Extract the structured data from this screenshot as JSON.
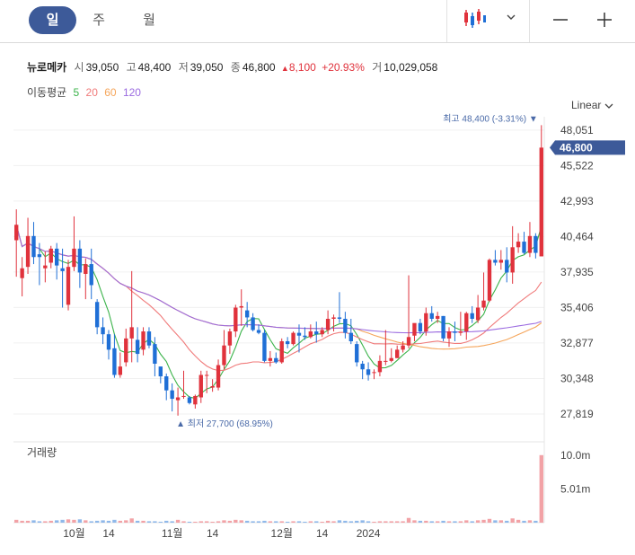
{
  "toolbar": {
    "tabs": [
      {
        "label": "일",
        "active": true
      },
      {
        "label": "주",
        "active": false
      },
      {
        "label": "월",
        "active": false
      }
    ],
    "chart_type_icon": "candlestick-icon",
    "dropdown_icon": "chevron-down-icon",
    "minimize_icon": "minus-icon",
    "add_icon": "plus-icon"
  },
  "quote": {
    "name": "뉴로메카",
    "open_label": "시",
    "open": "39,050",
    "high_label": "고",
    "high": "48,400",
    "low_label": "저",
    "low": "39,050",
    "close_label": "종",
    "close": "46,800",
    "change_icon": "up-triangle-icon",
    "change": "8,100",
    "change_pct": "+20.93%",
    "volume_label": "거",
    "volume": "10,029,058"
  },
  "moving_average": {
    "label": "이동평균",
    "periods": [
      {
        "period": "5",
        "color": "#3bb34a"
      },
      {
        "period": "20",
        "color": "#f07a7a"
      },
      {
        "period": "60",
        "color": "#f5a55a"
      },
      {
        "period": "120",
        "color": "#9b6be0"
      }
    ]
  },
  "scale_mode": "Linear",
  "volume_panel_label": "거래량",
  "colors": {
    "up": "#e0323c",
    "down": "#1f6fd6",
    "accent": "#3d5a99",
    "marker": "#4a6aa8"
  },
  "chart_data": {
    "type": "candlestick",
    "price_axis": {
      "min": 26600,
      "max": 49000,
      "ticks": [
        48051,
        45522,
        42993,
        40464,
        37935,
        35406,
        32877,
        30348,
        27819
      ],
      "tick_labels": [
        "48,051",
        "45,522",
        "42,993",
        "40,464",
        "37,935",
        "35,406",
        "32,877",
        "30,348",
        "27,819"
      ]
    },
    "current_price": {
      "value": 46800,
      "label": "46,800"
    },
    "high_marker": {
      "label": "최고",
      "value": 48400,
      "text": "48,400 (-3.31%)"
    },
    "low_marker": {
      "label": "최저",
      "value": 27700,
      "text": "27,700 (68.95%)"
    },
    "x_labels": [
      {
        "index": 10,
        "label": "10월"
      },
      {
        "index": 16,
        "label": "14"
      },
      {
        "index": 27,
        "label": "11월"
      },
      {
        "index": 34,
        "label": "14"
      },
      {
        "index": 46,
        "label": "12월"
      },
      {
        "index": 53,
        "label": "14"
      },
      {
        "index": 61,
        "label": "2024"
      }
    ],
    "volume_axis": {
      "max": 12000000,
      "ticks": [
        10000000,
        5010000
      ],
      "tick_labels": [
        "10.0m",
        "5.01m"
      ]
    },
    "candles": [
      [
        40200,
        42400,
        41300,
        37600,
        0.6
      ],
      [
        37500,
        39000,
        38200,
        36200,
        0.4
      ],
      [
        38300,
        41800,
        40500,
        37800,
        0.4
      ],
      [
        40500,
        41500,
        39000,
        38500,
        0.5
      ],
      [
        39200,
        40000,
        39000,
        37000,
        0.3
      ],
      [
        38200,
        39400,
        38400,
        37200,
        0.3
      ],
      [
        38600,
        39800,
        39600,
        38200,
        0.4
      ],
      [
        39600,
        40000,
        38400,
        37400,
        0.5
      ],
      [
        38200,
        39600,
        38000,
        35400,
        0.6
      ],
      [
        35600,
        38800,
        38300,
        35200,
        0.7
      ],
      [
        38300,
        41900,
        39600,
        38000,
        0.6
      ],
      [
        39600,
        40200,
        37900,
        36800,
        0.7
      ],
      [
        37800,
        38900,
        38500,
        36000,
        0.5
      ],
      [
        38500,
        39600,
        37000,
        36000,
        0.3
      ],
      [
        35800,
        36000,
        34000,
        33500,
        0.4
      ],
      [
        34000,
        34700,
        33500,
        32800,
        0.5
      ],
      [
        33500,
        33800,
        32400,
        31700,
        0.4
      ],
      [
        32500,
        33500,
        30600,
        30400,
        0.6
      ],
      [
        30600,
        32200,
        31200,
        30400,
        0.4
      ],
      [
        31500,
        33900,
        33200,
        31200,
        0.5
      ],
      [
        33200,
        38000,
        34000,
        31500,
        0.9
      ],
      [
        33100,
        34000,
        32100,
        31500,
        0.4
      ],
      [
        32400,
        34000,
        33700,
        32000,
        0.4
      ],
      [
        33700,
        34000,
        32700,
        32500,
        0.3
      ],
      [
        32800,
        33300,
        31400,
        30500,
        0.3
      ],
      [
        31200,
        31200,
        30500,
        30000,
        0.2
      ],
      [
        30500,
        30700,
        29500,
        28800,
        0.4
      ],
      [
        29500,
        30000,
        28900,
        28000,
        0.3
      ],
      [
        28800,
        29700,
        29000,
        27700,
        0.6
      ],
      [
        29100,
        30900,
        29100,
        28900,
        0.3
      ],
      [
        29000,
        29100,
        28600,
        28500,
        0.2
      ],
      [
        28500,
        29200,
        29100,
        28200,
        0.2
      ],
      [
        29000,
        30900,
        30600,
        28600,
        0.3
      ],
      [
        30600,
        30900,
        30600,
        29300,
        0.3
      ],
      [
        29700,
        30300,
        29800,
        29400,
        0.2
      ],
      [
        29700,
        31700,
        31300,
        29500,
        0.3
      ],
      [
        31300,
        33800,
        32700,
        31000,
        0.5
      ],
      [
        32700,
        33900,
        33700,
        32100,
        0.4
      ],
      [
        33700,
        35600,
        35400,
        33300,
        0.6
      ],
      [
        35400,
        36700,
        35500,
        34100,
        0.5
      ],
      [
        35200,
        35800,
        34700,
        34000,
        0.4
      ],
      [
        34700,
        35000,
        33800,
        33700,
        0.3
      ],
      [
        33800,
        34200,
        33600,
        33500,
        0.3
      ],
      [
        33600,
        33800,
        31600,
        31500,
        0.4
      ],
      [
        31600,
        32300,
        31800,
        31200,
        0.3
      ],
      [
        31800,
        32200,
        31500,
        31400,
        0.3
      ],
      [
        31500,
        33200,
        33000,
        31400,
        0.3
      ],
      [
        33000,
        33300,
        32800,
        32500,
        0.2
      ],
      [
        32800,
        33700,
        33600,
        32700,
        0.3
      ],
      [
        33600,
        34200,
        33400,
        32200,
        0.3
      ],
      [
        33400,
        34000,
        33300,
        33100,
        0.2
      ],
      [
        33300,
        34200,
        33700,
        33200,
        0.3
      ],
      [
        33700,
        34400,
        33500,
        32900,
        0.3
      ],
      [
        33500,
        34000,
        33800,
        33300,
        0.2
      ],
      [
        33800,
        35200,
        34600,
        33500,
        0.4
      ],
      [
        34600,
        34900,
        34700,
        33700,
        0.3
      ],
      [
        34700,
        36500,
        34600,
        34300,
        0.5
      ],
      [
        34600,
        35100,
        33600,
        33200,
        0.4
      ],
      [
        33600,
        34600,
        33000,
        32800,
        0.3
      ],
      [
        32800,
        33000,
        31500,
        31200,
        0.4
      ],
      [
        31400,
        31600,
        31000,
        30300,
        0.5
      ],
      [
        31000,
        31500,
        30600,
        30200,
        0.3
      ],
      [
        30800,
        31000,
        30800,
        30300,
        0.2
      ],
      [
        30800,
        32000,
        31600,
        30500,
        0.3
      ],
      [
        31600,
        33800,
        31600,
        31300,
        0.3
      ],
      [
        31600,
        32500,
        31800,
        31500,
        0.3
      ],
      [
        31800,
        32700,
        32400,
        31800,
        0.3
      ],
      [
        32400,
        33000,
        32700,
        32200,
        0.3
      ],
      [
        32700,
        37700,
        33300,
        32500,
        1.0
      ],
      [
        33400,
        34200,
        34300,
        33000,
        0.5
      ],
      [
        34300,
        34600,
        33700,
        33500,
        0.4
      ],
      [
        33700,
        35400,
        35000,
        33400,
        0.4
      ],
      [
        35000,
        35500,
        34600,
        34400,
        0.3
      ],
      [
        34600,
        35100,
        34800,
        34300,
        0.3
      ],
      [
        34800,
        34800,
        33200,
        33000,
        0.4
      ],
      [
        33200,
        34000,
        33700,
        32600,
        0.3
      ],
      [
        33700,
        34400,
        33600,
        33000,
        0.3
      ],
      [
        33600,
        35100,
        33700,
        33400,
        0.3
      ],
      [
        33700,
        35100,
        35000,
        33100,
        0.5
      ],
      [
        35000,
        35500,
        34600,
        34300,
        0.3
      ],
      [
        34500,
        36300,
        35400,
        34300,
        0.5
      ],
      [
        35400,
        37900,
        35900,
        35200,
        0.6
      ],
      [
        35900,
        38900,
        38800,
        35800,
        0.8
      ],
      [
        38800,
        39500,
        38600,
        38400,
        0.5
      ],
      [
        38600,
        39500,
        38800,
        38100,
        0.5
      ],
      [
        38800,
        39700,
        37900,
        37200,
        0.4
      ],
      [
        37900,
        41200,
        39700,
        37100,
        0.9
      ],
      [
        39700,
        40700,
        40100,
        39300,
        0.6
      ],
      [
        40100,
        40800,
        39300,
        39200,
        0.4
      ],
      [
        39300,
        41500,
        40500,
        39000,
        0.5
      ],
      [
        40500,
        40700,
        39300,
        38900,
        0.4
      ],
      [
        39050,
        48400,
        46800,
        39050,
        1.0
      ]
    ]
  }
}
